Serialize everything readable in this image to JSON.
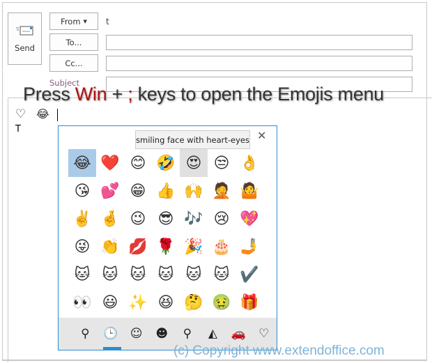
{
  "compose": {
    "send_label": "Send",
    "from_label": "From",
    "from_value": "t",
    "to_label": "To...",
    "cc_label": "Cc...",
    "subject_label": "Subject",
    "body_symbols": [
      "♡",
      "😂"
    ],
    "body_line2": "T"
  },
  "caption": {
    "part1": "Press ",
    "win": "Win",
    "plus": " + ",
    "semicolon": ";",
    "part2": " keys to open the Emojis menu"
  },
  "emoji_panel": {
    "tooltip": "smiling face with heart-eyes",
    "close": "✕",
    "emojis": [
      "😂",
      "❤️",
      "😊",
      "🤣",
      "😍",
      "😒",
      "👌",
      "😘",
      "💕",
      "😁",
      "👍",
      "🙌",
      "🤦",
      "🤷",
      "✌️",
      "🤞",
      "😉",
      "😎",
      "🎶",
      "😢",
      "💖",
      "😜",
      "👏",
      "💋",
      "🌹",
      "🎉",
      "🎂",
      "🤳",
      "🐱",
      "🐱",
      "🐱",
      "🐱",
      "🐱",
      "🐱",
      "✔️",
      "👀",
      "😃",
      "✨",
      "😆",
      "🤔",
      "🤢",
      "🎁"
    ],
    "selected_index": 0,
    "hovered_index": 4,
    "tabs": [
      {
        "icon": "search-icon",
        "glyph": "⚲"
      },
      {
        "icon": "recent-clock-icon",
        "glyph": "🕒",
        "active": true
      },
      {
        "icon": "smiley-icon",
        "glyph": "☺"
      },
      {
        "icon": "people-icon",
        "glyph": "☻"
      },
      {
        "icon": "balloon-icon",
        "glyph": "⚲"
      },
      {
        "icon": "pizza-icon",
        "glyph": "◭"
      },
      {
        "icon": "car-icon",
        "glyph": "🚗"
      },
      {
        "icon": "heart-icon",
        "glyph": "♡"
      }
    ],
    "accent": "#2b8dd0"
  },
  "watermark": "(c) Copyright www.extendoffice.com"
}
